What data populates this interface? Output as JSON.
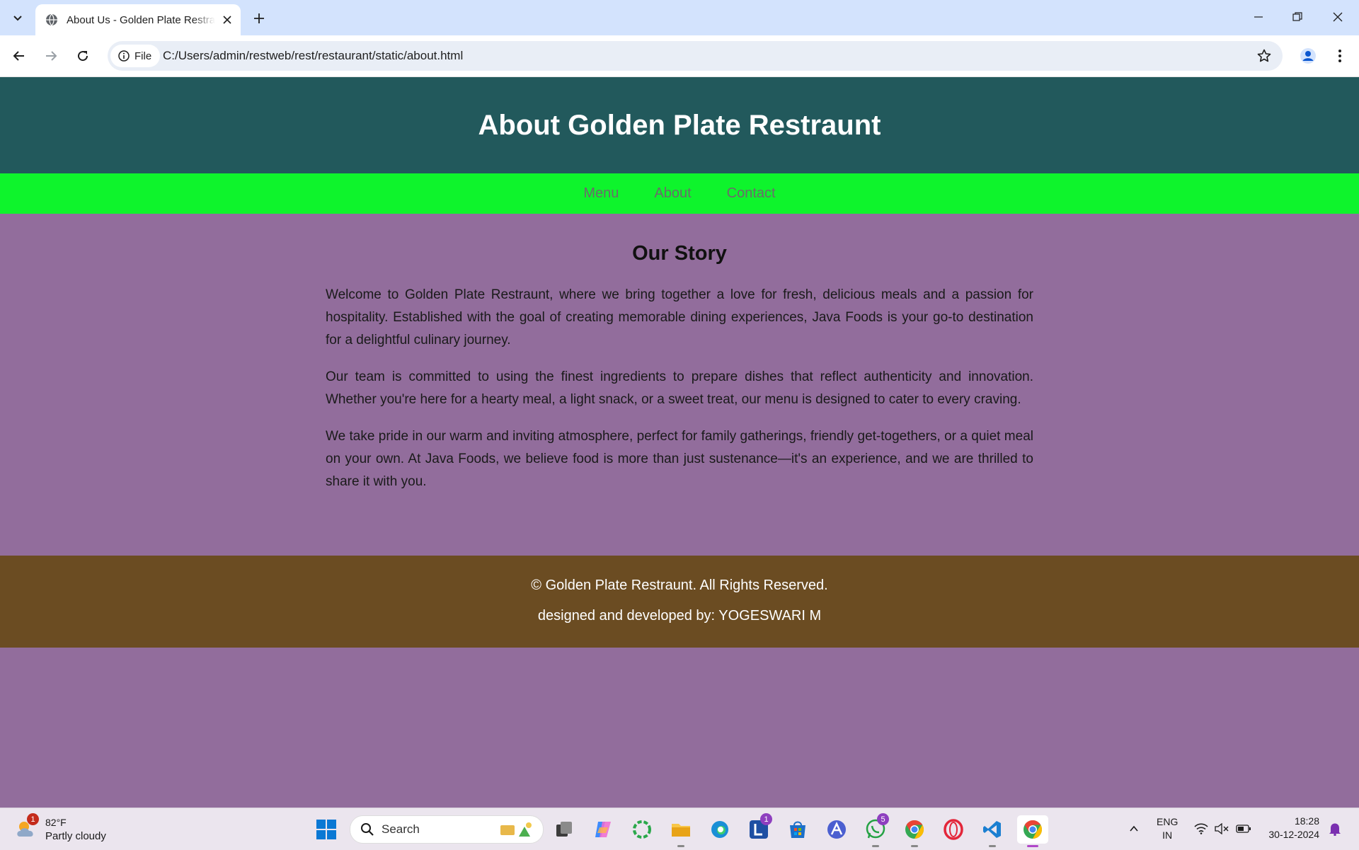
{
  "browser": {
    "tab_title": "About Us - Golden Plate Restraunt",
    "chip_label": "File",
    "url": "C:/Users/admin/restweb/rest/restaurant/static/about.html"
  },
  "page": {
    "header_title": "About Golden Plate Restraunt",
    "nav": [
      {
        "label": "Menu"
      },
      {
        "label": "About"
      },
      {
        "label": "Contact"
      }
    ],
    "story_heading": "Our Story",
    "paragraphs": [
      "Welcome to Golden Plate Restraunt, where we bring together a love for fresh, delicious meals and a passion for hospitality. Established with the goal of creating memorable dining experiences, Java Foods is your go-to destination for a delightful culinary journey.",
      "Our team is committed to using the finest ingredients to prepare dishes that reflect authenticity and innovation. Whether you're here for a hearty meal, a light snack, or a sweet treat, our menu is designed to cater to every craving.",
      "We take pride in our warm and inviting atmosphere, perfect for family gatherings, friendly get-togethers, or a quiet meal on your own. At Java Foods, we believe food is more than just sustenance—it's an experience, and we are thrilled to share it with you."
    ],
    "footer_copyright": "© Golden Plate Restraunt. All Rights Reserved.",
    "footer_credit": "designed and developed by: YOGESWARI M",
    "colors": {
      "header": "#22595c",
      "nav": "#0ef42c",
      "body": "#926d9c",
      "footer": "#6b4c22"
    }
  },
  "taskbar": {
    "weather_badge": "1",
    "weather_temp": "82°F",
    "weather_condition": "Partly cloudy",
    "search_placeholder": "Search",
    "l_app_badge": "1",
    "whatsapp_badge": "5",
    "lang_line1": "ENG",
    "lang_line2": "IN",
    "time": "18:28",
    "date": "30-12-2024"
  }
}
